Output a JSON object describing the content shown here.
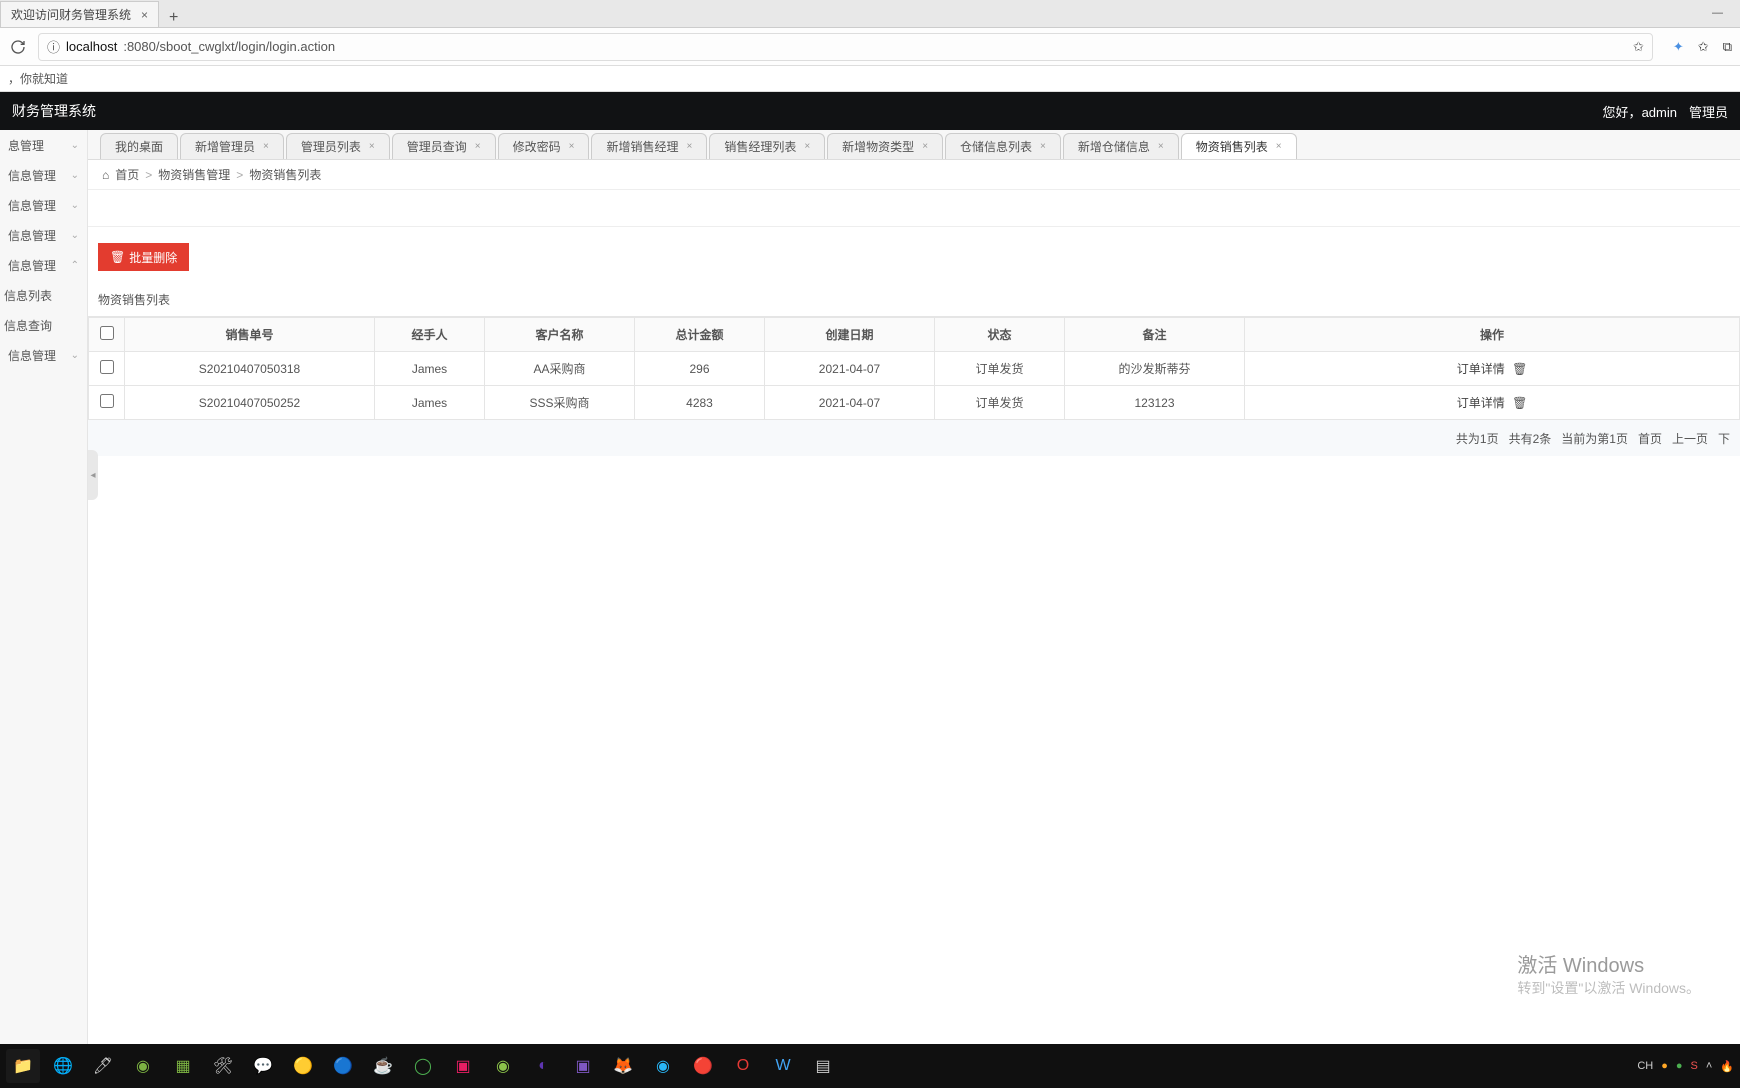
{
  "browser": {
    "tab_title": "欢迎访问财务管理系统",
    "url_host": "localhost",
    "url_port_path": ":8080/sboot_cwglxt/login/login.action",
    "bookmark": "，你就知道"
  },
  "app": {
    "title": "财务管理系统",
    "greeting": "您好，",
    "user": "admin",
    "role": "管理员"
  },
  "sidebar": {
    "items": [
      {
        "label": "息管理",
        "expand": true
      },
      {
        "label": "信息管理",
        "expand": true
      },
      {
        "label": "信息管理",
        "expand": true
      },
      {
        "label": "信息管理",
        "expand": true
      },
      {
        "label": "信息管理",
        "expand": false
      },
      {
        "label": "信息列表",
        "sub": true
      },
      {
        "label": "信息查询",
        "sub": true
      },
      {
        "label": "信息管理",
        "expand": true
      }
    ]
  },
  "tabs": [
    {
      "label": "我的桌面",
      "closable": false
    },
    {
      "label": "新增管理员",
      "closable": true
    },
    {
      "label": "管理员列表",
      "closable": true
    },
    {
      "label": "管理员查询",
      "closable": true
    },
    {
      "label": "修改密码",
      "closable": true
    },
    {
      "label": "新增销售经理",
      "closable": true
    },
    {
      "label": "销售经理列表",
      "closable": true
    },
    {
      "label": "新增物资类型",
      "closable": true
    },
    {
      "label": "仓储信息列表",
      "closable": true
    },
    {
      "label": "新增仓储信息",
      "closable": true
    },
    {
      "label": "物资销售列表",
      "closable": true,
      "active": true
    }
  ],
  "breadcrumb": {
    "home": "首页",
    "seg1": "物资销售管理",
    "seg2": "物资销售列表"
  },
  "buttons": {
    "batch_delete": "批量删除"
  },
  "panel": {
    "title": "物资销售列表"
  },
  "table": {
    "headers": {
      "checkbox": "",
      "order_no": "销售单号",
      "handler": "经手人",
      "customer": "客户名称",
      "total": "总计金额",
      "create_date": "创建日期",
      "status": "状态",
      "remark": "备注",
      "operate": "操作"
    },
    "rows": [
      {
        "order_no": "S20210407050318",
        "handler": "James",
        "customer": "AA采购商",
        "total": "296",
        "create_date": "2021-04-07",
        "status": "订单发货",
        "remark": "的沙发斯蒂芬",
        "op_detail": "订单详情"
      },
      {
        "order_no": "S20210407050252",
        "handler": "James",
        "customer": "SSS采购商",
        "total": "4283",
        "create_date": "2021-04-07",
        "status": "订单发货",
        "remark": "123123",
        "op_detail": "订单详情"
      }
    ]
  },
  "pager": {
    "total_pages": "共为1页",
    "total_records": "共有2条",
    "current": "当前为第1页",
    "first": "首页",
    "prev": "上一页",
    "next": "下"
  },
  "watermark": {
    "line1": "激活 Windows",
    "line2": "转到\"设置\"以激活 Windows。"
  },
  "taskbar": {
    "ime": "CH"
  }
}
